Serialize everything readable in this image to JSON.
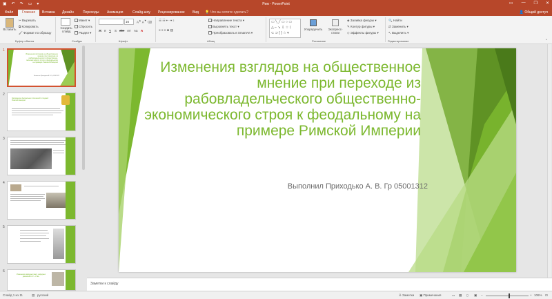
{
  "window": {
    "title": "Рим - PowerPoint",
    "share_label": "Общий доступ",
    "tell_me": "Что вы хотите сделать?",
    "qat_icons": [
      "save-icon",
      "undo-icon",
      "redo-icon",
      "start-presentation-icon",
      "customize-icon"
    ]
  },
  "tabs": [
    "Файл",
    "Главная",
    "Вставка",
    "Дизайн",
    "Переходы",
    "Анимация",
    "Слайд-шоу",
    "Рецензирование",
    "Вид"
  ],
  "active_tab": "Главная",
  "ribbon": {
    "clipboard": {
      "paste": "Вставить",
      "cut": "Вырезать",
      "copy": "Копировать",
      "format": "Формат по образцу",
      "label": "Буфер обмена"
    },
    "slides": {
      "new": "Создать слайд",
      "layout": "Макет",
      "reset": "Сбросить",
      "section": "Раздел",
      "label": "Слайды"
    },
    "font": {
      "size": "16",
      "label": "Шрифт"
    },
    "paragraph": {
      "direction": "Направление текста",
      "align": "Выровнять текст",
      "smartart": "Преобразовать в SmartArt",
      "label": "Абзац"
    },
    "drawing": {
      "arrange": "Упорядочить",
      "styles": "Экспресс-стили",
      "fill": "Заливка фигуры",
      "outline": "Контур фигуры",
      "effects": "Эффекты фигуры",
      "label": "Рисование"
    },
    "editing": {
      "find": "Найти",
      "replace": "Заменить",
      "select": "Выделить",
      "label": "Редактирование"
    }
  },
  "thumbnails": [
    {
      "num": "1",
      "title": "Изменения взглядов на общественное мнение при переходе из рабовладельческого общественно-экономического строя к феодальному на примере Римской Империи"
    },
    {
      "num": "2",
      "title": "Зарождение феодальных отношений в поздней Римской империи"
    },
    {
      "num": "3",
      "title": ""
    },
    {
      "num": "4",
      "title": ""
    },
    {
      "num": "5",
      "title": ""
    },
    {
      "num": "6",
      "title": "Изменения народных масс, народных движений в IV—VI вв."
    }
  ],
  "slide": {
    "title": "Изменения взглядов на общественное мнение при переходе из рабовладельческого общественно-экономического строя к феодальному на примере Римской Империи",
    "subtitle": "Выполнил Приходько А. В. Гр 05001312"
  },
  "notes_placeholder": "Заметки к слайду",
  "status": {
    "slide_counter": "Слайд 1 из 11",
    "language": "русский",
    "notes_btn": "Заметки",
    "comments_btn": "Примечания",
    "zoom": "106%"
  },
  "colors": {
    "accent": "#b7472a",
    "green": "#7cb82f",
    "selected_border": "#d35230"
  }
}
